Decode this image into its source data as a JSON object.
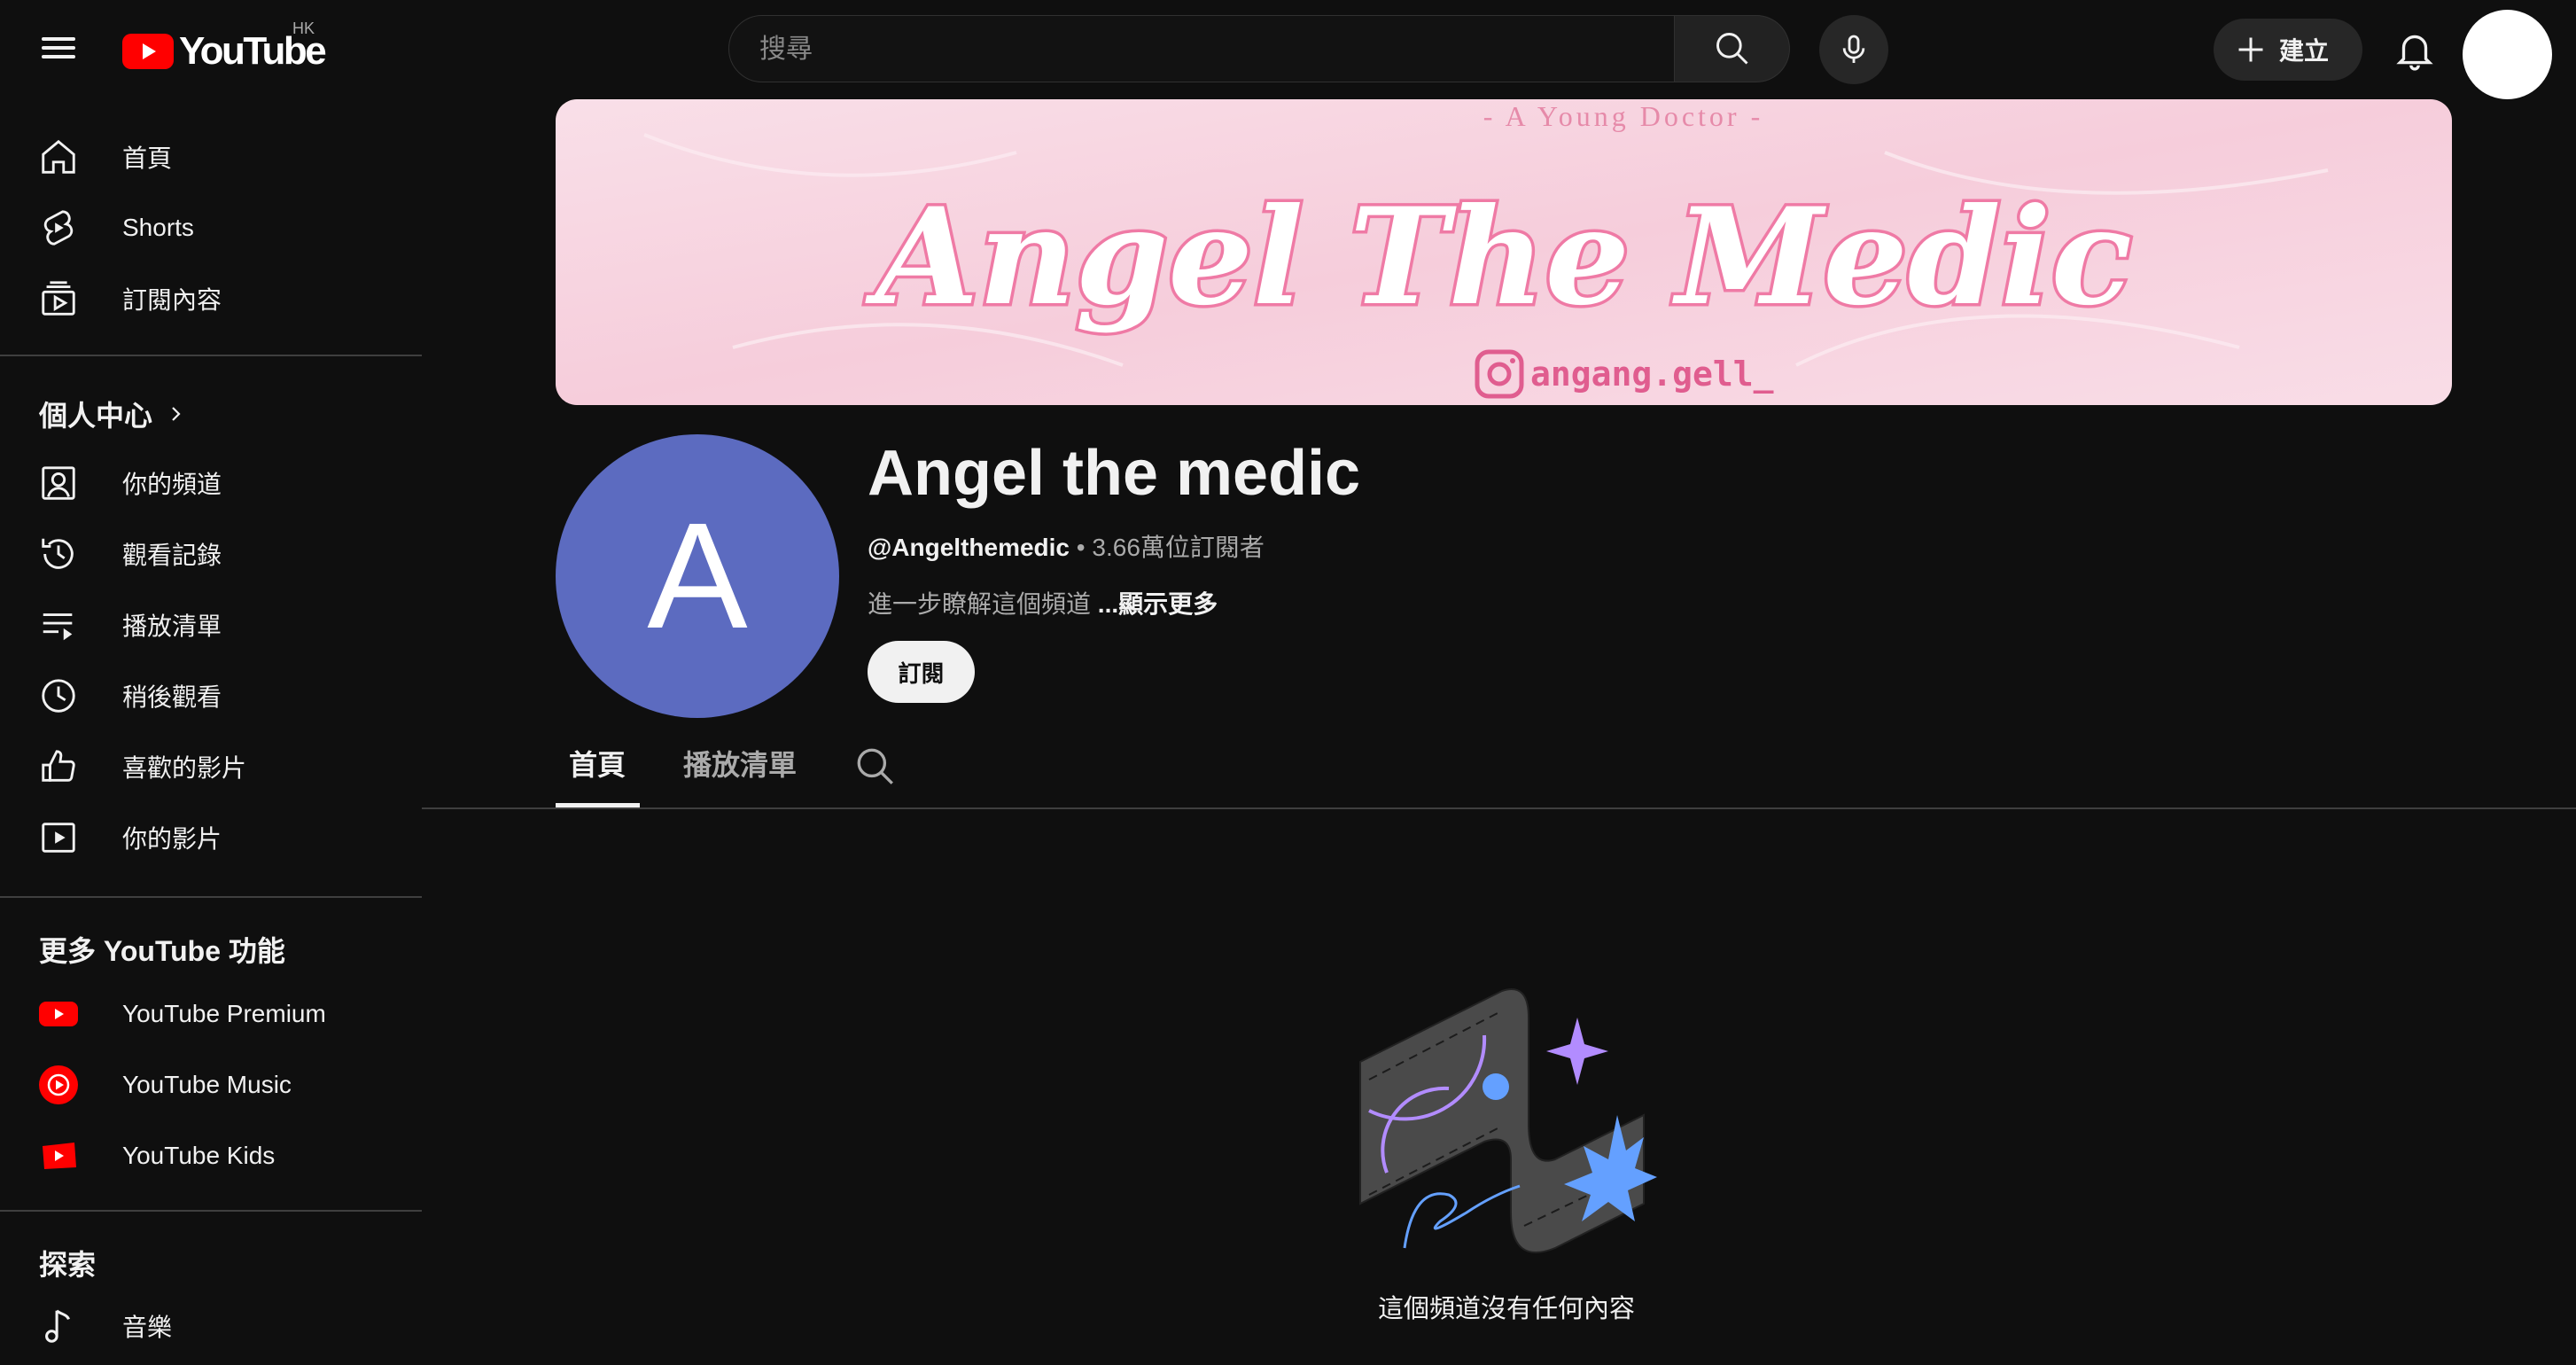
{
  "header": {
    "logo_text": "YouTube",
    "region": "HK",
    "search_placeholder": "搜尋",
    "create_label": "建立"
  },
  "sidebar": {
    "primary": [
      {
        "label": "首頁",
        "icon": "home-icon"
      },
      {
        "label": "Shorts",
        "icon": "shorts-icon"
      },
      {
        "label": "訂閱內容",
        "icon": "subscriptions-icon"
      }
    ],
    "you_title": "個人中心",
    "you_items": [
      {
        "label": "你的頻道",
        "icon": "your-channel-icon"
      },
      {
        "label": "觀看記錄",
        "icon": "history-icon"
      },
      {
        "label": "播放清單",
        "icon": "playlists-icon"
      },
      {
        "label": "稍後觀看",
        "icon": "watch-later-icon"
      },
      {
        "label": "喜歡的影片",
        "icon": "liked-videos-icon"
      },
      {
        "label": "你的影片",
        "icon": "your-videos-icon"
      }
    ],
    "more_title": "更多 YouTube 功能",
    "more_items": [
      {
        "label": "YouTube Premium",
        "icon": "youtube-premium-icon"
      },
      {
        "label": "YouTube Music",
        "icon": "youtube-music-icon"
      },
      {
        "label": "YouTube Kids",
        "icon": "youtube-kids-icon"
      }
    ],
    "explore_title": "探索",
    "explore_items": [
      {
        "label": "音樂",
        "icon": "music-note-icon"
      }
    ]
  },
  "banner": {
    "tagline": "- A Young Doctor -",
    "title": "Angel The Medic",
    "instagram_handle": "angang.gell_"
  },
  "channel": {
    "avatar_letter": "A",
    "name": "Angel the medic",
    "handle": "@Angelthemedic",
    "separator": "•",
    "subscribers": "3.66萬位訂閱者",
    "description_prefix": "進一步瞭解這個頻道",
    "show_more": "...顯示更多",
    "subscribe_label": "訂閱"
  },
  "tabs": [
    {
      "label": "首頁",
      "selected": true
    },
    {
      "label": "播放清單",
      "selected": false
    }
  ],
  "empty_state": {
    "message": "這個頻道沒有任何內容"
  },
  "colors": {
    "background": "#0f0f0f",
    "brand_red": "#ff0000",
    "avatar_bg": "#5c6bc0",
    "banner_pink": "#f8d3df",
    "banner_text": "#ef7aa5"
  }
}
